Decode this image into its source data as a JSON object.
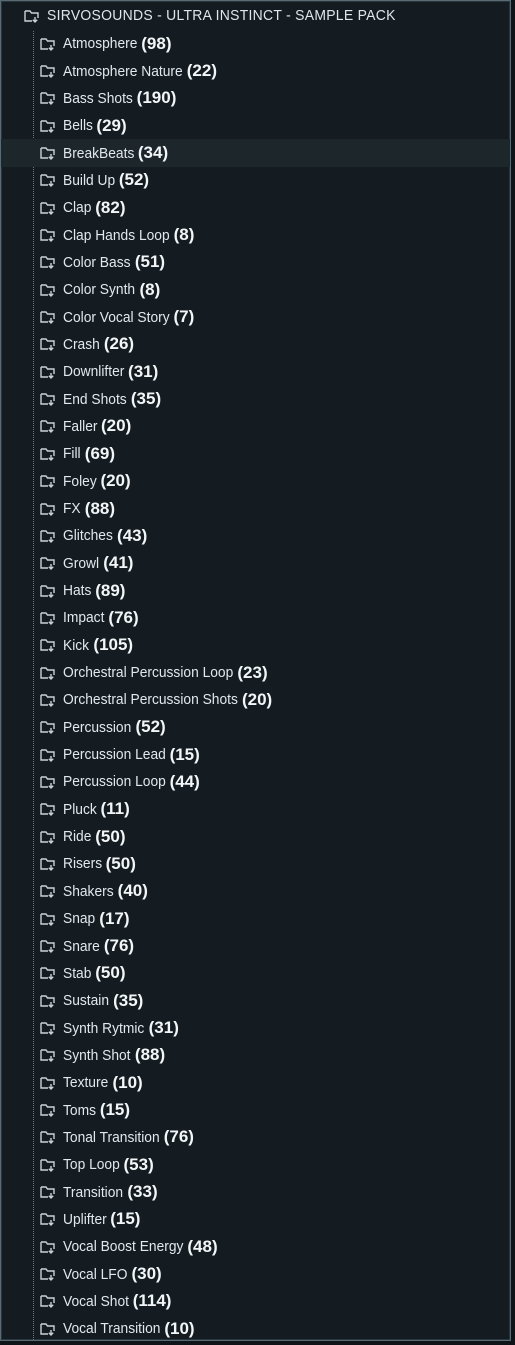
{
  "window": {
    "title": "SIRVOSOUNDS - ULTRA INSTINCT - SAMPLE PACK",
    "root_icon": "folder-arrow-icon"
  },
  "folder_icon": "folder-arrow-icon",
  "highlight_color": "#1d262b",
  "items": [
    {
      "label": "Atmosphere",
      "count": "(98)"
    },
    {
      "label": "Atmosphere Nature",
      "count": "(22)"
    },
    {
      "label": "Bass Shots",
      "count": "(190)"
    },
    {
      "label": "Bells",
      "count": "(29)"
    },
    {
      "label": "BreakBeats",
      "count": "(34)",
      "selected": true
    },
    {
      "label": "Build Up",
      "count": "(52)"
    },
    {
      "label": "Clap",
      "count": "(82)"
    },
    {
      "label": "Clap Hands Loop",
      "count": "(8)"
    },
    {
      "label": "Color Bass",
      "count": "(51)"
    },
    {
      "label": "Color Synth",
      "count": "(8)"
    },
    {
      "label": "Color Vocal Story",
      "count": "(7)"
    },
    {
      "label": "Crash",
      "count": "(26)"
    },
    {
      "label": "Downlifter",
      "count": "(31)"
    },
    {
      "label": "End Shots",
      "count": "(35)"
    },
    {
      "label": "Faller",
      "count": "(20)"
    },
    {
      "label": "Fill",
      "count": "(69)"
    },
    {
      "label": "Foley",
      "count": "(20)"
    },
    {
      "label": "FX",
      "count": "(88)"
    },
    {
      "label": "Glitches",
      "count": "(43)"
    },
    {
      "label": "Growl",
      "count": "(41)"
    },
    {
      "label": "Hats",
      "count": "(89)"
    },
    {
      "label": "Impact",
      "count": "(76)"
    },
    {
      "label": "Kick",
      "count": "(105)"
    },
    {
      "label": "Orchestral Percussion Loop",
      "count": "(23)"
    },
    {
      "label": "Orchestral Percussion Shots",
      "count": "(20)"
    },
    {
      "label": "Percussion",
      "count": "(52)"
    },
    {
      "label": "Percussion Lead",
      "count": "(15)"
    },
    {
      "label": "Percussion Loop",
      "count": "(44)"
    },
    {
      "label": "Pluck",
      "count": "(11)"
    },
    {
      "label": "Ride",
      "count": "(50)"
    },
    {
      "label": "Risers",
      "count": "(50)"
    },
    {
      "label": "Shakers",
      "count": "(40)"
    },
    {
      "label": "Snap",
      "count": "(17)"
    },
    {
      "label": "Snare",
      "count": "(76)"
    },
    {
      "label": "Stab",
      "count": "(50)"
    },
    {
      "label": "Sustain",
      "count": "(35)"
    },
    {
      "label": "Synth Rytmic",
      "count": "(31)"
    },
    {
      "label": "Synth Shot",
      "count": "(88)"
    },
    {
      "label": "Texture",
      "count": "(10)"
    },
    {
      "label": "Toms",
      "count": "(15)"
    },
    {
      "label": "Tonal Transition",
      "count": "(76)"
    },
    {
      "label": "Top Loop",
      "count": "(53)"
    },
    {
      "label": "Transition",
      "count": "(33)"
    },
    {
      "label": "Uplifter",
      "count": "(15)"
    },
    {
      "label": "Vocal Boost Energy",
      "count": "(48)"
    },
    {
      "label": "Vocal LFO",
      "count": "(30)"
    },
    {
      "label": "Vocal Shot",
      "count": "(114)"
    },
    {
      "label": "Vocal Transition",
      "count": "(10)"
    }
  ]
}
